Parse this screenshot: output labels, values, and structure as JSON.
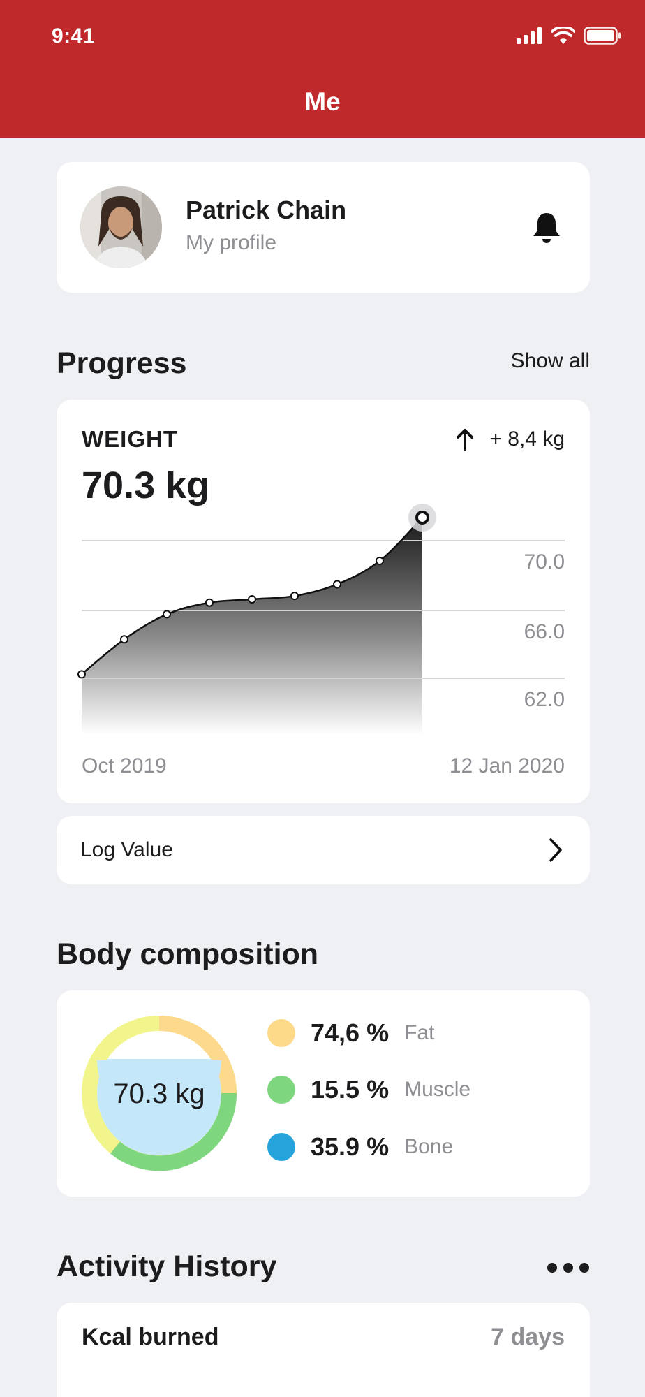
{
  "status_bar": {
    "time": "9:41"
  },
  "header": {
    "title": "Me"
  },
  "profile": {
    "name": "Patrick Chain",
    "subtitle": "My profile"
  },
  "progress": {
    "title": "Progress",
    "show_all": "Show all",
    "weight": {
      "label": "WEIGHT",
      "value": "70.3 kg",
      "delta": "+ 8,4 kg",
      "start_label": "Oct 2019",
      "end_label": "12 Jan 2020"
    },
    "log_value": "Log Value"
  },
  "chart_data": {
    "type": "area",
    "title": "",
    "xlabel": "",
    "ylabel": "",
    "x": [
      "Oct 2019",
      "",
      "",
      "",
      "",
      "",
      "",
      "",
      "12 Jan 2020"
    ],
    "values": [
      61.9,
      64.0,
      65.5,
      66.2,
      66.4,
      66.6,
      67.3,
      68.7,
      71.3
    ],
    "y_ticks": [
      "70.0",
      "66.0",
      "62.0"
    ],
    "ylim": [
      58.0,
      72.0
    ],
    "grid": true,
    "colors": {
      "line": "#111111",
      "fill_top": "#1a1a1a",
      "fill_bottom": "#ffffff"
    }
  },
  "body_composition": {
    "title": "Body composition",
    "total": "70.3 kg",
    "items": [
      {
        "value": "74,6 %",
        "name": "Fat",
        "color": "#fdd98a"
      },
      {
        "value": "15.5 %",
        "name": "Muscle",
        "color": "#7ed67f"
      },
      {
        "value": "35.9 %",
        "name": "Bone",
        "color": "#27a3dc"
      }
    ],
    "ring_colors": {
      "yellow_light": "#f2f58c",
      "orange_light": "#fcd98c",
      "green": "#7ed67f",
      "center": "#c4e8fa"
    }
  },
  "activity": {
    "title": "Activity History",
    "metric": "Kcal burned",
    "range": "7 days"
  },
  "colors": {
    "header": "#c0292c",
    "background": "#eff0f4"
  }
}
